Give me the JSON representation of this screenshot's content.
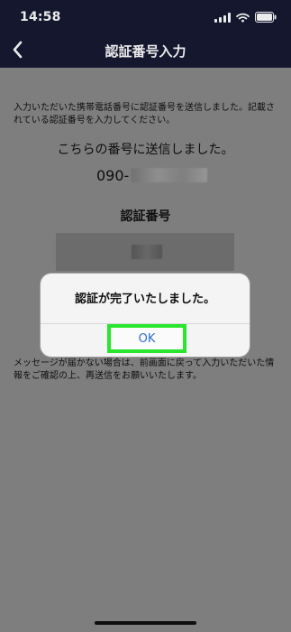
{
  "status_bar": {
    "time": "14:58",
    "icons": [
      "signal-icon",
      "wifi-icon",
      "battery-icon"
    ]
  },
  "header": {
    "title": "認証番号入力",
    "back_icon": "back-chevron-icon"
  },
  "main": {
    "description": "入力いただいた携帯電話番号に認証番号を送信しました。記載されている認証番号を入力してください。",
    "sent_message": "こちらの番号に送信しました。",
    "phone_prefix": "090-",
    "code_label": "認証番号",
    "help_text": "メッセージが届かない場合は、前画面に戻って入力いただいた情報をご確認の上、再送信をお願いいたします。"
  },
  "modal": {
    "title": "認証が完了いたしました。",
    "ok_label": "OK"
  },
  "colors": {
    "header_background": "#171a33",
    "modal_button_outline": "#28e62d",
    "modal_button_text": "#2f6fd1"
  }
}
